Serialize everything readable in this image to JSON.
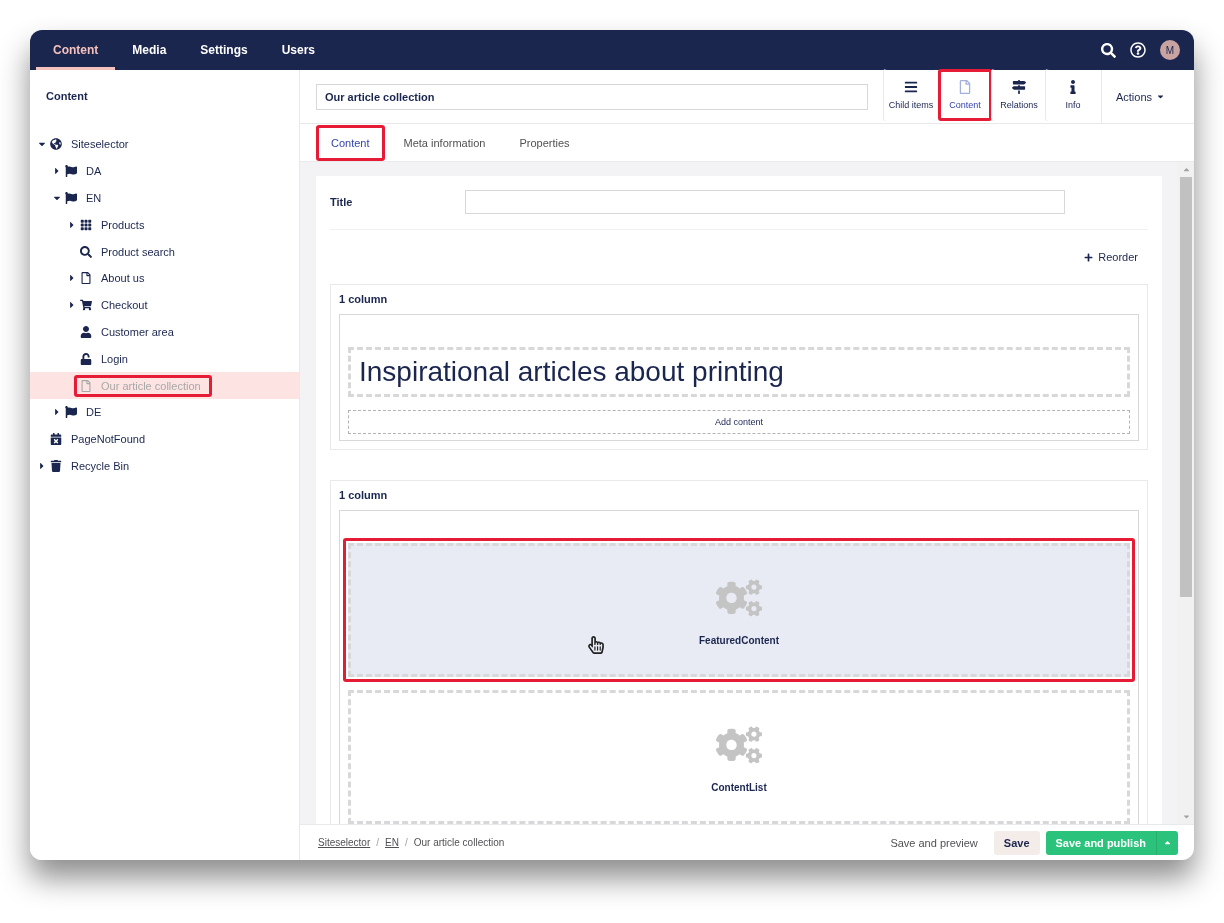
{
  "top_nav": {
    "sections": [
      {
        "label": "Content",
        "selected": true
      },
      {
        "label": "Media",
        "selected": false
      },
      {
        "label": "Settings",
        "selected": false
      },
      {
        "label": "Users",
        "selected": false
      }
    ],
    "avatar": "M"
  },
  "sidebar": {
    "title": "Content",
    "tree": [
      {
        "label": "Siteselector",
        "kind": "site",
        "expandable": true,
        "expanded": true,
        "selected": false,
        "highlighted": false,
        "children": [
          {
            "label": "DA",
            "kind": "language",
            "expandable": true,
            "expanded": false,
            "selected": false,
            "highlighted": false
          },
          {
            "label": "EN",
            "kind": "language",
            "expandable": true,
            "expanded": true,
            "selected": false,
            "highlighted": false,
            "children": [
              {
                "label": "Products",
                "kind": "catalog",
                "expandable": true,
                "expanded": false,
                "selected": false,
                "highlighted": false
              },
              {
                "label": "Product search",
                "kind": "search",
                "expandable": false,
                "selected": false,
                "highlighted": false
              },
              {
                "label": "About us",
                "kind": "page",
                "expandable": true,
                "expanded": false,
                "selected": false,
                "highlighted": false
              },
              {
                "label": "Checkout",
                "kind": "checkout",
                "expandable": true,
                "expanded": false,
                "selected": false,
                "highlighted": false
              },
              {
                "label": "Customer area",
                "kind": "profile",
                "expandable": false,
                "selected": false,
                "highlighted": false
              },
              {
                "label": "Login",
                "kind": "login",
                "expandable": false,
                "selected": false,
                "highlighted": false
              },
              {
                "label": "Our article collection",
                "kind": "article",
                "expandable": false,
                "selected": true,
                "highlighted": true
              }
            ]
          },
          {
            "label": "DE",
            "kind": "language",
            "expandable": true,
            "expanded": false,
            "selected": false,
            "highlighted": false
          }
        ]
      },
      {
        "label": "PageNotFound",
        "kind": "error",
        "expandable": false,
        "selected": false,
        "highlighted": false
      },
      {
        "label": "Recycle Bin",
        "kind": "bin",
        "expandable": true,
        "expanded": false,
        "selected": false,
        "highlighted": false
      }
    ]
  },
  "editor": {
    "name": "Our article collection",
    "apps": [
      {
        "label": "Child items",
        "kind": "list",
        "selected": false,
        "highlighted": false
      },
      {
        "label": "Content",
        "kind": "document",
        "selected": true,
        "highlighted": true
      },
      {
        "label": "Relations",
        "kind": "relations",
        "selected": false,
        "highlighted": false
      },
      {
        "label": "Info",
        "kind": "info",
        "selected": false,
        "highlighted": false
      }
    ],
    "actions": "Actions",
    "tabs": [
      {
        "label": "Content",
        "selected": true,
        "highlighted": true
      },
      {
        "label": "Meta information",
        "selected": false,
        "highlighted": false
      },
      {
        "label": "Properties",
        "selected": false,
        "highlighted": false
      }
    ],
    "title_field": {
      "label": "Title"
    },
    "reorder": "Reorder",
    "sections": [
      {
        "label": "1 column",
        "add_label": "Add content",
        "blocks": [
          {
            "kind": "heading",
            "text": "Inspirational articles about printing",
            "hovered": false,
            "highlighted": false
          }
        ]
      },
      {
        "label": "1 column",
        "blocks": [
          {
            "kind": "macro",
            "text": "FeaturedContent",
            "hovered": true,
            "highlighted": true
          },
          {
            "kind": "macro",
            "text": "ContentList",
            "hovered": false,
            "highlighted": false
          }
        ]
      }
    ]
  },
  "footer": {
    "breadcrumb": [
      {
        "label": "Siteselector",
        "link": true
      },
      {
        "label": "EN",
        "link": true
      },
      {
        "label": "Our article collection",
        "link": false
      }
    ],
    "separator": "/",
    "buttons": [
      {
        "label": "Save and preview",
        "kind": "link"
      },
      {
        "label": "Save",
        "kind": "secondary"
      },
      {
        "label": "Save and publish",
        "kind": "primary"
      }
    ]
  }
}
